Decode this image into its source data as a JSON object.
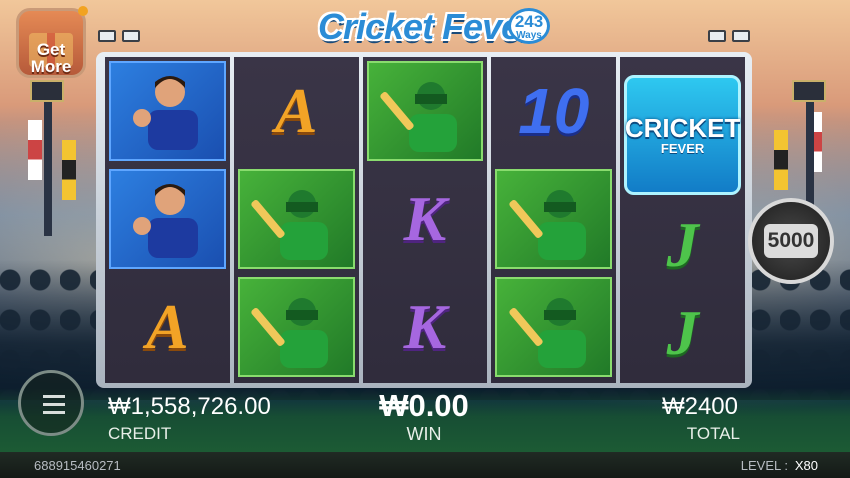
{
  "game": {
    "title": "Cricket Fever",
    "ways_number": "243",
    "ways_label": "Ways"
  },
  "get_more": {
    "label": "Get More"
  },
  "reels": [
    [
      "player-celebrating",
      "player-celebrating",
      "A"
    ],
    [
      "A",
      "batsman",
      "batsman"
    ],
    [
      "batsman",
      "K",
      "K"
    ],
    [
      "10",
      "batsman",
      "batsman"
    ],
    [
      "scatter",
      "J",
      "J"
    ]
  ],
  "symbols": {
    "letter_a": "A",
    "letter_k": "K",
    "letter_j": "J",
    "ten": "10",
    "scatter_line1": "CRICKET",
    "scatter_line2": "FEVER"
  },
  "bet_button": {
    "value": "5000"
  },
  "credit": {
    "value": "₩1,558,726.00",
    "label": "CREDIT"
  },
  "win": {
    "value": "₩0.00",
    "label": "WIN"
  },
  "total": {
    "value": "₩2400",
    "label": "TOTAL"
  },
  "footer": {
    "ticket_id": "688915460271",
    "level_label": "LEVEL :",
    "level_value": "X80"
  },
  "colors": {
    "scatter_bg": "#1ea3e0",
    "green_band": "#1c5b34",
    "credit_text": "#ffffff"
  }
}
